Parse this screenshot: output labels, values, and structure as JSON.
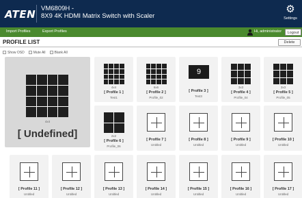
{
  "header": {
    "logo": "ATEN",
    "model_line1": "VM6809H -",
    "model_line2": "8X9 4K HDMI Matrix Switch with Scaler",
    "settings_label": "Settings",
    "settings_icon": "gear-icon"
  },
  "toolbar": {
    "import_label": "Import Profiles",
    "export_label": "Export Profiles",
    "user_text": "Hi, administrator",
    "logout_label": "Logout"
  },
  "profile_list": {
    "title": "PROFILE LIST",
    "delete_label": "Delete",
    "options": [
      {
        "label": "Show OSD",
        "checked": false
      },
      {
        "label": "Mute All",
        "checked": false
      },
      {
        "label": "Blank All",
        "checked": false
      }
    ],
    "big_card": {
      "type": "4x4",
      "name": "[ Undefined]"
    },
    "cards": [
      {
        "type": "4x4",
        "name": "[ Profile 1 ]",
        "sub": "Test1",
        "icon": "grid-4x4"
      },
      {
        "type": "6x6",
        "name": "[ Profile 2 ]",
        "sub": "Profile_02",
        "icon": "grid-4x4"
      },
      {
        "type": "",
        "name": "[ Profile 3 ]",
        "sub": "Test3",
        "icon": "screen",
        "screen_text": "9"
      },
      {
        "type": "3x3",
        "name": "[ Profile 4 ]",
        "sub": "Profile_04",
        "icon": "grid-3x3"
      },
      {
        "type": "3x3",
        "name": "[ Profile 5 ]",
        "sub": "Profile_05",
        "icon": "grid-3x3"
      },
      {
        "type": "2x2",
        "name": "[ Profile 6 ]",
        "sub": "Profile_06",
        "icon": "grid-2x2"
      },
      {
        "type": "",
        "name": "[ Profile 7 ]",
        "sub": "Untitled",
        "icon": "plus"
      },
      {
        "type": "",
        "name": "[ Profile 8 ]",
        "sub": "Untitled",
        "icon": "plus"
      },
      {
        "type": "",
        "name": "[ Profile 9 ]",
        "sub": "Untitled",
        "icon": "plus"
      },
      {
        "type": "",
        "name": "[ Profile 10 ]",
        "sub": "Untitled",
        "icon": "plus"
      },
      {
        "type": "",
        "name": "[ Profile 11 ]",
        "sub": "Untitled",
        "icon": "plus"
      },
      {
        "type": "",
        "name": "[ Profile 12 ]",
        "sub": "Untitled",
        "icon": "plus"
      },
      {
        "type": "",
        "name": "[ Profile 13 ]",
        "sub": "Untitled",
        "icon": "plus"
      },
      {
        "type": "",
        "name": "[ Profile 14 ]",
        "sub": "Untitled",
        "icon": "plus"
      },
      {
        "type": "",
        "name": "[ Profile 15 ]",
        "sub": "Untitled",
        "icon": "plus"
      },
      {
        "type": "",
        "name": "[ Profile 16 ]",
        "sub": "Untitled",
        "icon": "plus"
      },
      {
        "type": "",
        "name": "[ Profile 17 ]",
        "sub": "Untitled",
        "icon": "plus"
      }
    ]
  }
}
